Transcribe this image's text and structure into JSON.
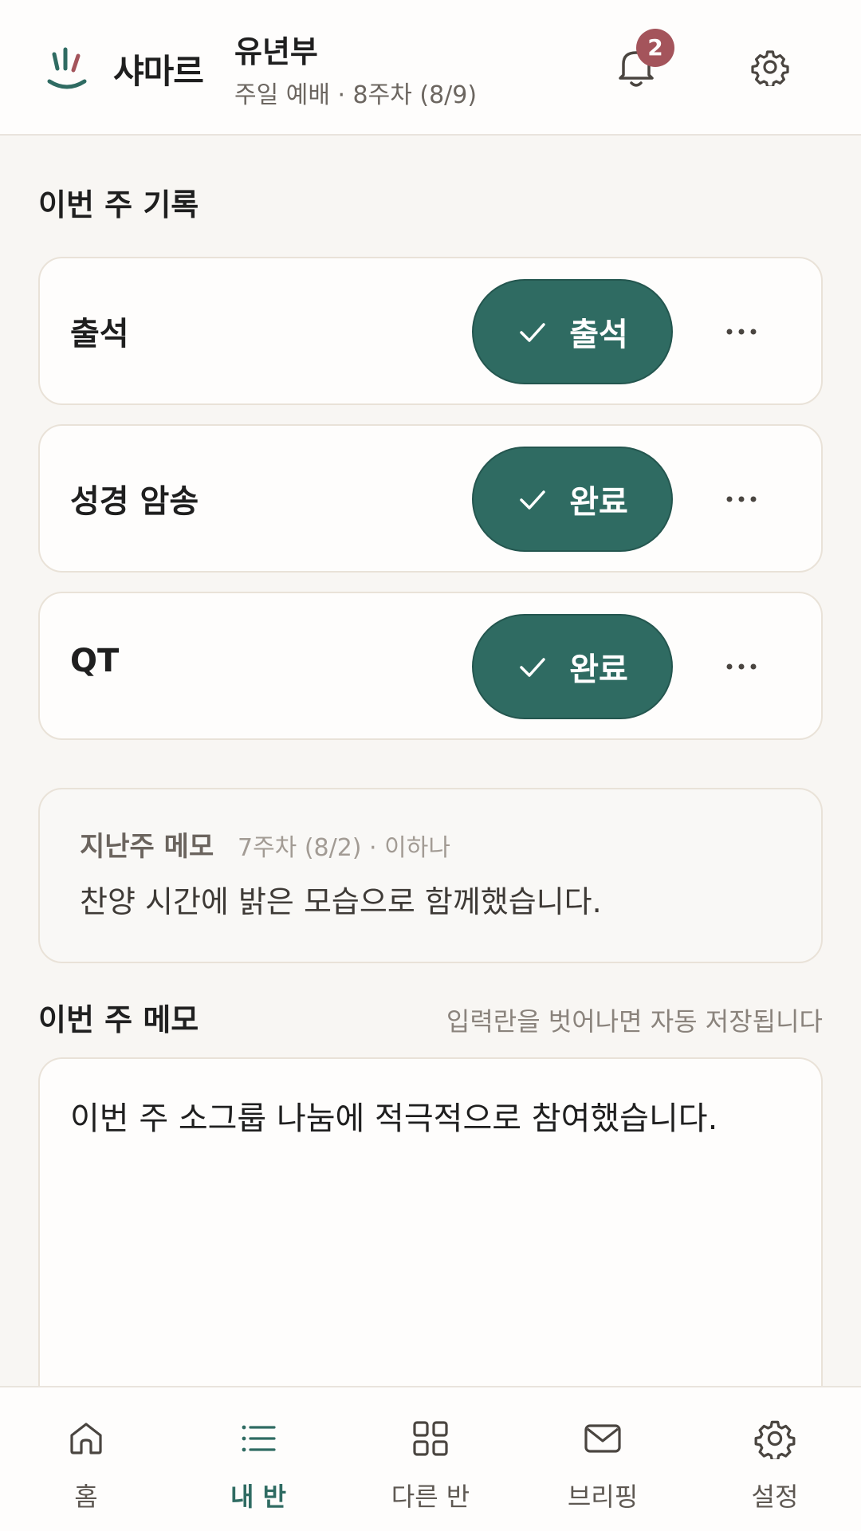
{
  "header": {
    "app_name": "샤마르",
    "class_name": "유년부",
    "subtitle": "주일 예배 · 8주차 (8/9)",
    "notification_count": "2",
    "logo_icon": "hand-logo-icon",
    "bell_icon": "bell-icon",
    "settings_icon": "gear-icon"
  },
  "records": {
    "title": "이번 주 기록",
    "items": [
      {
        "label": "출석",
        "status": "출석"
      },
      {
        "label": "성경 암송",
        "status": "완료"
      },
      {
        "label": "QT",
        "status": "완료"
      }
    ]
  },
  "last_memo": {
    "title": "지난주 메모",
    "meta": "7주차 (8/2) · 이하나",
    "text": "찬양 시간에 밝은 모습으로 함께했습니다."
  },
  "this_memo": {
    "title": "이번 주 메모",
    "hint": "입력란을 벗어나면 자동 저장됩니다",
    "text": "이번 주 소그룹 나눔에 적극적으로 참여했습니다."
  },
  "nav": {
    "items": [
      {
        "label": "홈",
        "icon": "home-icon"
      },
      {
        "label": "내 반",
        "icon": "list-icon"
      },
      {
        "label": "다른 반",
        "icon": "grid-icon"
      },
      {
        "label": "브리핑",
        "icon": "mail-icon"
      },
      {
        "label": "설정",
        "icon": "gear-icon"
      }
    ],
    "active_index": 1
  },
  "colors": {
    "accent": "#2f6b62",
    "badge": "#a4545b",
    "background": "#f8f6f3"
  }
}
